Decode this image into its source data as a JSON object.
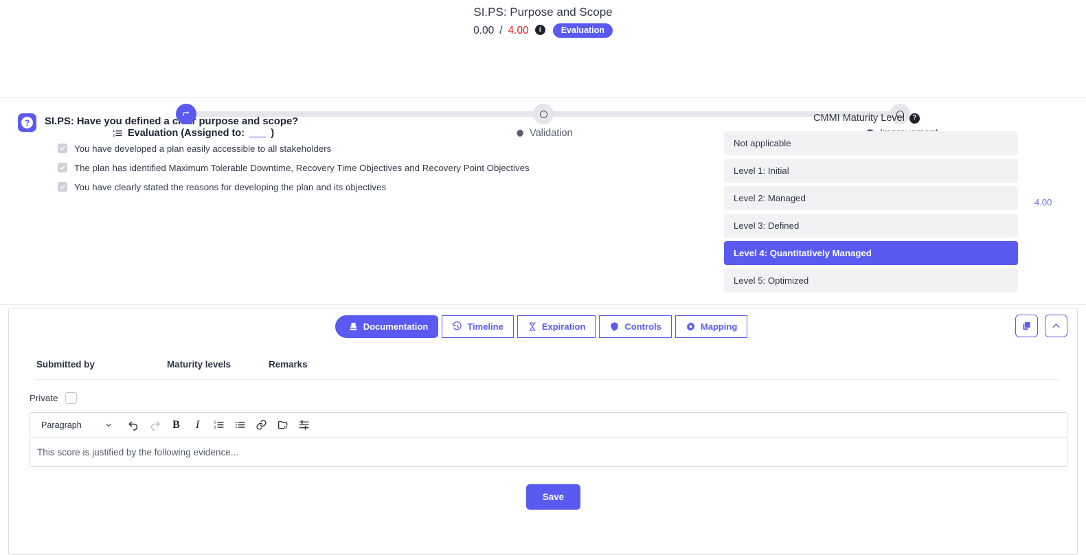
{
  "header": {
    "title": "SI.PS: Purpose and Scope",
    "score_current": "0.00",
    "score_separator": "/",
    "score_max": "4.00",
    "info_icon": "info-icon",
    "phase_badge": "Evaluation",
    "accent_color": "#5a5af0",
    "max_score_color": "#e02020"
  },
  "stepper": {
    "steps": [
      {
        "key": "evaluation",
        "label": "Evaluation (Assigned to:",
        "label_suffix": ")",
        "assigned_to": "___",
        "icon": "ordered-list-icon",
        "node_icon": "pen-icon",
        "state": "active"
      },
      {
        "key": "validation",
        "label": "Validation",
        "icon": "gear-icon",
        "node_icon": "circle-icon",
        "state": "idle"
      },
      {
        "key": "improvement",
        "label": "Improvement",
        "icon": "arrow-up-circle-icon",
        "node_icon": "circle-icon",
        "state": "idle"
      }
    ]
  },
  "question": {
    "badge_icon": "question-mark-icon",
    "title": "SI.PS: Have you defined a clear purpose and scope?",
    "criteria": [
      {
        "checked": true,
        "text": "You have developed a plan easily accessible to all stakeholders"
      },
      {
        "checked": true,
        "text": "The plan has identified Maximum Tolerable Downtime, Recovery Time Objectives and Recovery Point Objectives"
      },
      {
        "checked": true,
        "text": "You have clearly stated the reasons for developing the plan and its objectives"
      }
    ]
  },
  "maturity": {
    "title": "CMMI Maturity Level",
    "help_icon": "help-icon",
    "score": "4.00",
    "levels": [
      {
        "label": "Not applicable",
        "selected": false
      },
      {
        "label": "Level 1: Initial",
        "selected": false
      },
      {
        "label": "Level 2: Managed",
        "selected": false
      },
      {
        "label": "Level 3: Defined",
        "selected": false
      },
      {
        "label": "Level 4: Quantitatively Managed",
        "selected": true
      },
      {
        "label": "Level 5: Optimized",
        "selected": false
      }
    ]
  },
  "tabs": [
    {
      "key": "documentation",
      "label": "Documentation",
      "icon": "stamp-icon",
      "active": true
    },
    {
      "key": "timeline",
      "label": "Timeline",
      "icon": "history-clock-icon",
      "active": false
    },
    {
      "key": "expiration",
      "label": "Expiration",
      "icon": "hourglass-icon",
      "active": false
    },
    {
      "key": "controls",
      "label": "Controls",
      "icon": "shield-icon",
      "active": false
    },
    {
      "key": "mapping",
      "label": "Mapping",
      "icon": "gear-mapping-icon",
      "active": false
    }
  ],
  "tab_actions": [
    {
      "key": "duplicate",
      "icon": "copy-icon"
    },
    {
      "key": "collapse",
      "icon": "chevron-up-icon"
    }
  ],
  "table": {
    "columns": [
      "Submitted by",
      "Maturity levels",
      "Remarks"
    ],
    "rows": []
  },
  "editor": {
    "private_label": "Private",
    "private_checked": false,
    "block_format": "Paragraph",
    "toolbar": [
      {
        "key": "undo",
        "icon": "undo-icon",
        "disabled": false
      },
      {
        "key": "redo",
        "icon": "redo-icon",
        "disabled": true
      },
      {
        "key": "bold",
        "icon": "bold-icon",
        "glyph": "B",
        "disabled": false
      },
      {
        "key": "italic",
        "icon": "italic-icon",
        "glyph": "I",
        "disabled": false
      },
      {
        "key": "ordered-list",
        "icon": "ordered-list-icon",
        "disabled": false
      },
      {
        "key": "bullet-list",
        "icon": "bullet-list-icon",
        "disabled": false
      },
      {
        "key": "link",
        "icon": "link-icon",
        "disabled": false
      },
      {
        "key": "insert-media",
        "icon": "insert-media-icon",
        "disabled": false
      },
      {
        "key": "horizontal-rule",
        "icon": "horizontal-rule-icon",
        "disabled": false
      }
    ],
    "placeholder": "This score is justified by the following evidence...",
    "value": "",
    "save_label": "Save"
  }
}
